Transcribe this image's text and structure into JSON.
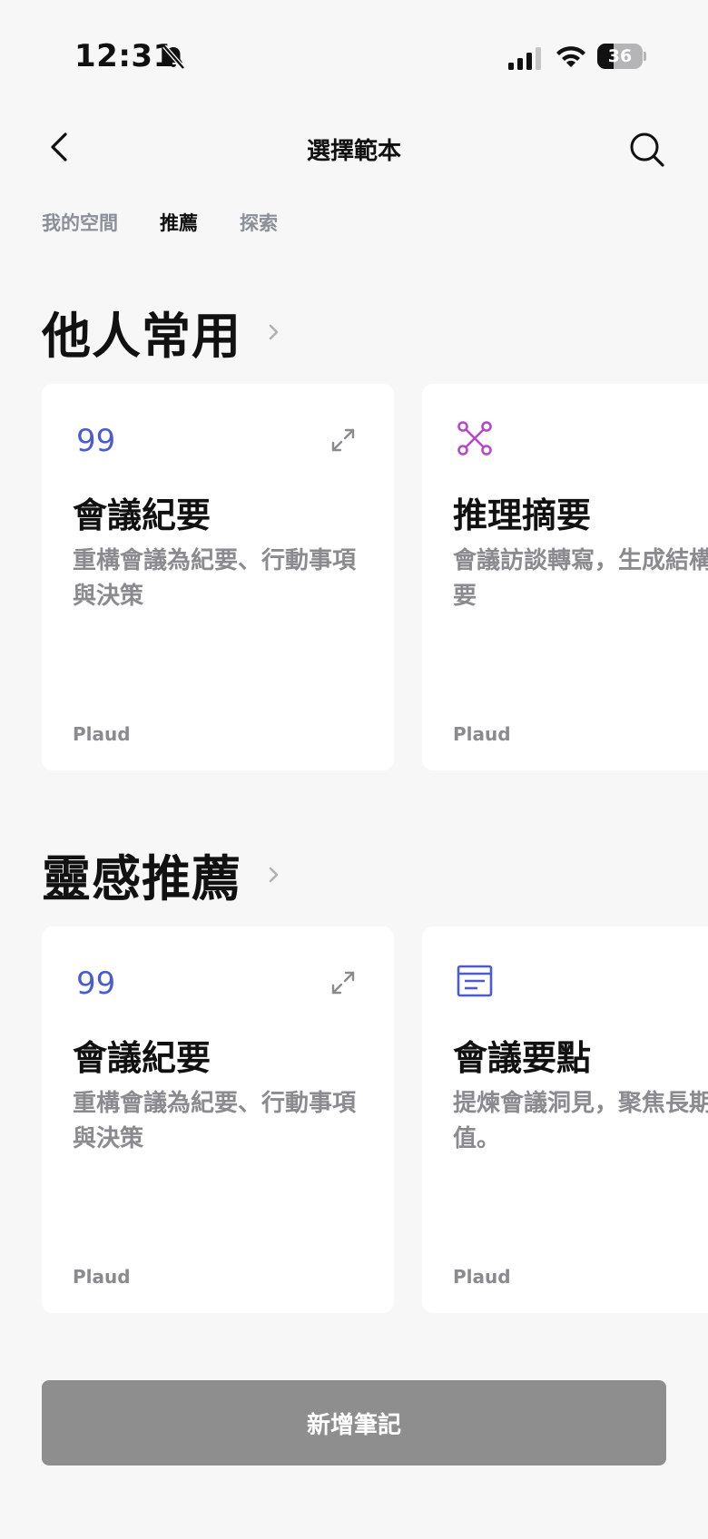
{
  "status_bar": {
    "time": "12:31",
    "battery": "36",
    "battery_level": 0.36
  },
  "header": {
    "title": "選擇範本"
  },
  "tabs": [
    {
      "label": "我的空間",
      "active": false
    },
    {
      "label": "推薦",
      "active": true
    },
    {
      "label": "探索",
      "active": false
    }
  ],
  "sections": [
    {
      "title": "他人常用",
      "cards": [
        {
          "icon": "quote-icon",
          "title": "會議紀要",
          "desc": "重構會議為紀要、行動事項與決策",
          "author": "Plaud"
        },
        {
          "icon": "network-icon",
          "title": "推理摘要",
          "desc": "會議訪談轉寫，生成結構化摘要",
          "author": "Plaud"
        }
      ]
    },
    {
      "title": "靈感推薦",
      "cards": [
        {
          "icon": "quote-icon",
          "title": "會議紀要",
          "desc": "重構會議為紀要、行動事項與決策",
          "author": "Plaud"
        },
        {
          "icon": "notes-icon",
          "title": "會議要點",
          "desc": "提煉會議洞見，聚焦長期價值。",
          "author": "Plaud"
        }
      ]
    }
  ],
  "add_button": {
    "label": "新增筆記"
  },
  "colors": {
    "quote": "#4a5ccf",
    "network": "#b44ac6",
    "notes": "#4a5ccf",
    "button": "#8e8e8e"
  }
}
